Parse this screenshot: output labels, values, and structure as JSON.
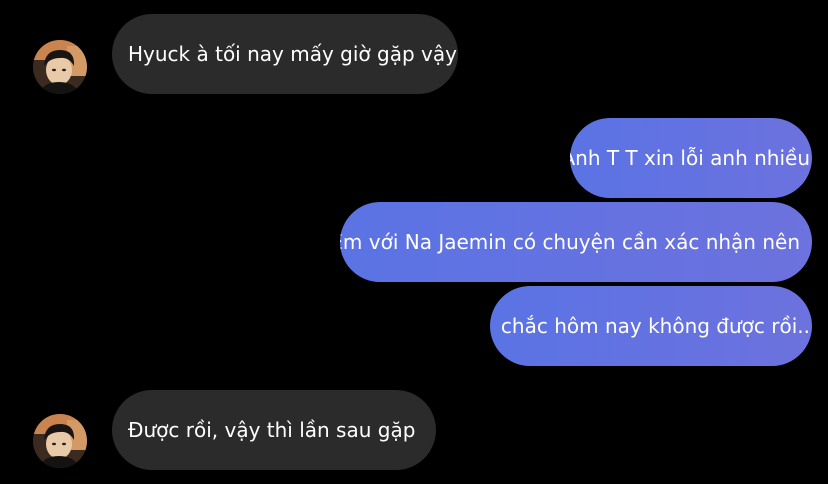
{
  "contact": {
    "avatar_icon": "contact-avatar-photo"
  },
  "colors": {
    "background": "#000000",
    "received_bubble": "#2b2b2b",
    "sent_bubble_start": "#5b73e4",
    "sent_bubble_end": "#6c72de",
    "text": "#ffffff"
  },
  "messages": [
    {
      "direction": "received",
      "text": "Hyuck à tối nay mấy giờ gặp vậy?"
    },
    {
      "direction": "sent",
      "text": "Anh T T xin lỗi anh nhiều"
    },
    {
      "direction": "sent",
      "text": "Em với Na Jaemin có chuyện cần xác nhận nên"
    },
    {
      "direction": "sent",
      "text": "chắc hôm nay không được rồi.."
    },
    {
      "direction": "received",
      "text": "Được rồi, vậy thì lần sau gặp"
    }
  ]
}
